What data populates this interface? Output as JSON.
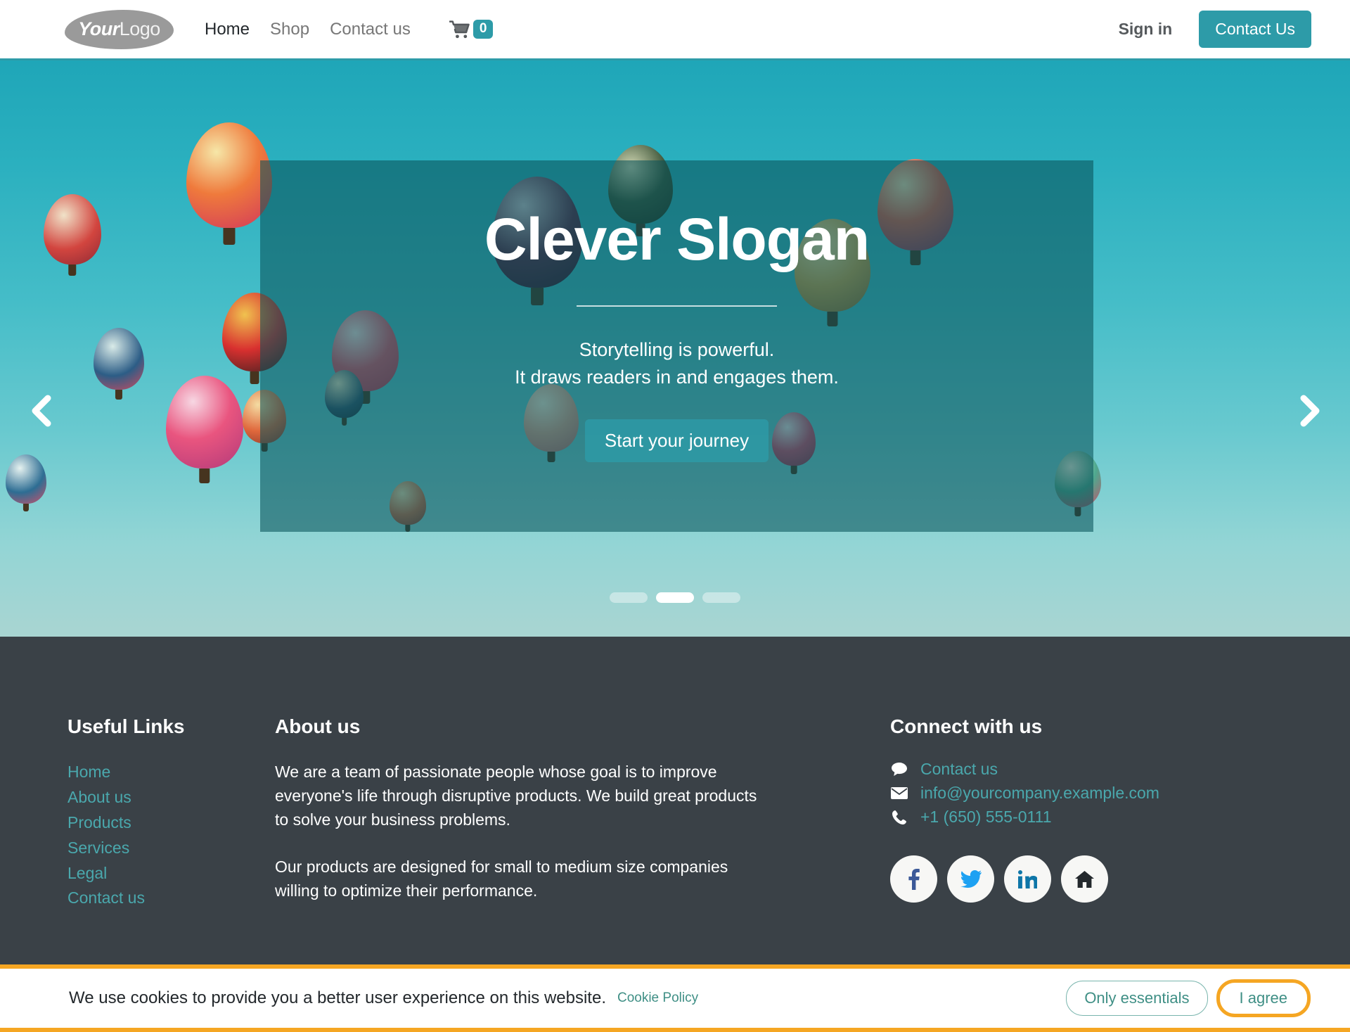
{
  "header": {
    "logo": {
      "bold_part": "Your",
      "light_part": "Logo",
      "alt": "your-logo"
    },
    "nav": [
      {
        "label": "Home",
        "active": true
      },
      {
        "label": "Shop",
        "active": false
      },
      {
        "label": "Contact us",
        "active": false
      }
    ],
    "cart": {
      "icon": "shopping-cart-icon",
      "count": "0"
    },
    "sign_in_label": "Sign in",
    "contact_button_label": "Contact Us",
    "accent_color": "#2d9ba8"
  },
  "hero": {
    "title": "Clever Slogan",
    "subtitle_line1": "Storytelling is powerful.",
    "subtitle_line2": "It draws readers in and engages them.",
    "cta_label": "Start your journey",
    "prev_icon": "chevron-left-icon",
    "next_icon": "chevron-right-icon",
    "slides": [
      {
        "active": false
      },
      {
        "active": true
      },
      {
        "active": false
      }
    ],
    "overlay_color": "#08525a",
    "sky_top_color": "#1fa6b8",
    "sky_bottom_color": "#a9d5d2"
  },
  "footer": {
    "background_color": "#3a4147",
    "link_color": "#4aa8ad",
    "useful_links": {
      "heading": "Useful Links",
      "items": [
        {
          "label": "Home"
        },
        {
          "label": "About us"
        },
        {
          "label": "Products"
        },
        {
          "label": "Services"
        },
        {
          "label": "Legal"
        },
        {
          "label": "Contact us"
        }
      ]
    },
    "about": {
      "heading": "About us",
      "paragraph1": "We are a team of passionate people whose goal is to improve everyone's life through disruptive products. We build great products to solve your business problems.",
      "paragraph2": "Our products are designed for small to medium size companies willing to optimize their performance."
    },
    "connect": {
      "heading": "Connect with us",
      "rows": [
        {
          "icon": "speech-bubble-icon",
          "label": "Contact us"
        },
        {
          "icon": "envelope-icon",
          "label": "info@yourcompany.example.com"
        },
        {
          "icon": "phone-icon",
          "label": "+1 (650) 555-0111"
        }
      ],
      "socials": [
        {
          "icon": "facebook-icon",
          "color": "#3b5998"
        },
        {
          "icon": "twitter-icon",
          "color": "#1da1f2"
        },
        {
          "icon": "linkedin-icon",
          "color": "#0e76a8"
        },
        {
          "icon": "home-icon",
          "color": "#23282c"
        }
      ]
    }
  },
  "cookie_bar": {
    "message": "We use cookies to provide you a better user experience on this website.",
    "policy_link": "Cookie Policy",
    "essentials_label": "Only essentials",
    "agree_label": "I agree",
    "highlight_color": "#f5a623"
  }
}
